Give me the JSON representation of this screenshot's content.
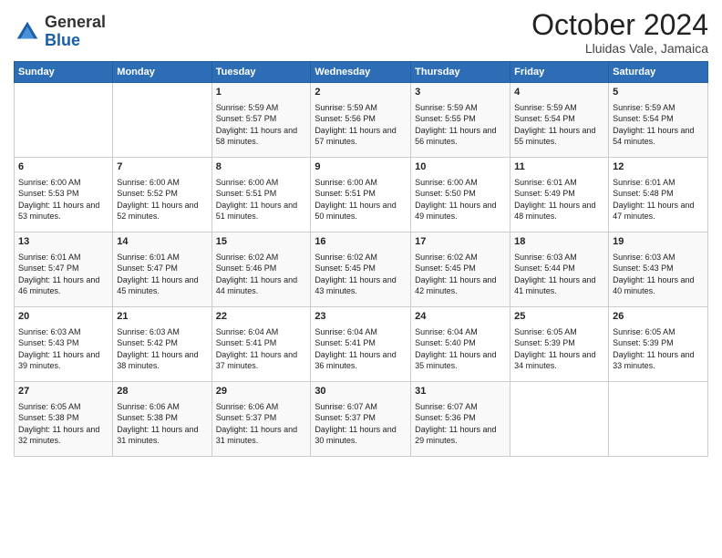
{
  "header": {
    "logo": {
      "general": "General",
      "blue": "Blue"
    },
    "title": "October 2024",
    "location": "Lluidas Vale, Jamaica"
  },
  "calendar": {
    "days_of_week": [
      "Sunday",
      "Monday",
      "Tuesday",
      "Wednesday",
      "Thursday",
      "Friday",
      "Saturday"
    ],
    "weeks": [
      [
        {
          "day": "",
          "info": ""
        },
        {
          "day": "",
          "info": ""
        },
        {
          "day": "1",
          "info": "Sunrise: 5:59 AM\nSunset: 5:57 PM\nDaylight: 11 hours and 58 minutes."
        },
        {
          "day": "2",
          "info": "Sunrise: 5:59 AM\nSunset: 5:56 PM\nDaylight: 11 hours and 57 minutes."
        },
        {
          "day": "3",
          "info": "Sunrise: 5:59 AM\nSunset: 5:55 PM\nDaylight: 11 hours and 56 minutes."
        },
        {
          "day": "4",
          "info": "Sunrise: 5:59 AM\nSunset: 5:54 PM\nDaylight: 11 hours and 55 minutes."
        },
        {
          "day": "5",
          "info": "Sunrise: 5:59 AM\nSunset: 5:54 PM\nDaylight: 11 hours and 54 minutes."
        }
      ],
      [
        {
          "day": "6",
          "info": "Sunrise: 6:00 AM\nSunset: 5:53 PM\nDaylight: 11 hours and 53 minutes."
        },
        {
          "day": "7",
          "info": "Sunrise: 6:00 AM\nSunset: 5:52 PM\nDaylight: 11 hours and 52 minutes."
        },
        {
          "day": "8",
          "info": "Sunrise: 6:00 AM\nSunset: 5:51 PM\nDaylight: 11 hours and 51 minutes."
        },
        {
          "day": "9",
          "info": "Sunrise: 6:00 AM\nSunset: 5:51 PM\nDaylight: 11 hours and 50 minutes."
        },
        {
          "day": "10",
          "info": "Sunrise: 6:00 AM\nSunset: 5:50 PM\nDaylight: 11 hours and 49 minutes."
        },
        {
          "day": "11",
          "info": "Sunrise: 6:01 AM\nSunset: 5:49 PM\nDaylight: 11 hours and 48 minutes."
        },
        {
          "day": "12",
          "info": "Sunrise: 6:01 AM\nSunset: 5:48 PM\nDaylight: 11 hours and 47 minutes."
        }
      ],
      [
        {
          "day": "13",
          "info": "Sunrise: 6:01 AM\nSunset: 5:47 PM\nDaylight: 11 hours and 46 minutes."
        },
        {
          "day": "14",
          "info": "Sunrise: 6:01 AM\nSunset: 5:47 PM\nDaylight: 11 hours and 45 minutes."
        },
        {
          "day": "15",
          "info": "Sunrise: 6:02 AM\nSunset: 5:46 PM\nDaylight: 11 hours and 44 minutes."
        },
        {
          "day": "16",
          "info": "Sunrise: 6:02 AM\nSunset: 5:45 PM\nDaylight: 11 hours and 43 minutes."
        },
        {
          "day": "17",
          "info": "Sunrise: 6:02 AM\nSunset: 5:45 PM\nDaylight: 11 hours and 42 minutes."
        },
        {
          "day": "18",
          "info": "Sunrise: 6:03 AM\nSunset: 5:44 PM\nDaylight: 11 hours and 41 minutes."
        },
        {
          "day": "19",
          "info": "Sunrise: 6:03 AM\nSunset: 5:43 PM\nDaylight: 11 hours and 40 minutes."
        }
      ],
      [
        {
          "day": "20",
          "info": "Sunrise: 6:03 AM\nSunset: 5:43 PM\nDaylight: 11 hours and 39 minutes."
        },
        {
          "day": "21",
          "info": "Sunrise: 6:03 AM\nSunset: 5:42 PM\nDaylight: 11 hours and 38 minutes."
        },
        {
          "day": "22",
          "info": "Sunrise: 6:04 AM\nSunset: 5:41 PM\nDaylight: 11 hours and 37 minutes."
        },
        {
          "day": "23",
          "info": "Sunrise: 6:04 AM\nSunset: 5:41 PM\nDaylight: 11 hours and 36 minutes."
        },
        {
          "day": "24",
          "info": "Sunrise: 6:04 AM\nSunset: 5:40 PM\nDaylight: 11 hours and 35 minutes."
        },
        {
          "day": "25",
          "info": "Sunrise: 6:05 AM\nSunset: 5:39 PM\nDaylight: 11 hours and 34 minutes."
        },
        {
          "day": "26",
          "info": "Sunrise: 6:05 AM\nSunset: 5:39 PM\nDaylight: 11 hours and 33 minutes."
        }
      ],
      [
        {
          "day": "27",
          "info": "Sunrise: 6:05 AM\nSunset: 5:38 PM\nDaylight: 11 hours and 32 minutes."
        },
        {
          "day": "28",
          "info": "Sunrise: 6:06 AM\nSunset: 5:38 PM\nDaylight: 11 hours and 31 minutes."
        },
        {
          "day": "29",
          "info": "Sunrise: 6:06 AM\nSunset: 5:37 PM\nDaylight: 11 hours and 31 minutes."
        },
        {
          "day": "30",
          "info": "Sunrise: 6:07 AM\nSunset: 5:37 PM\nDaylight: 11 hours and 30 minutes."
        },
        {
          "day": "31",
          "info": "Sunrise: 6:07 AM\nSunset: 5:36 PM\nDaylight: 11 hours and 29 minutes."
        },
        {
          "day": "",
          "info": ""
        },
        {
          "day": "",
          "info": ""
        }
      ]
    ]
  }
}
